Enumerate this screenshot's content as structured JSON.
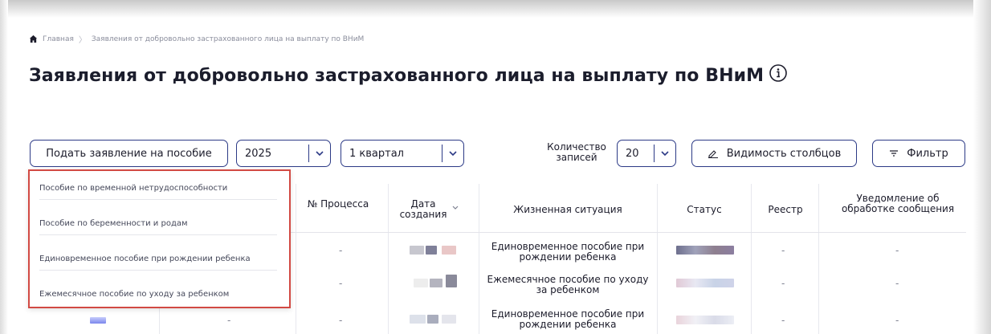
{
  "breadcrumb": {
    "home": "Главная",
    "current": "Заявления от добровольно застрахованного лица на выплату по ВНиМ"
  },
  "page": {
    "title": "Заявления от добровольно застрахованного лица на выплату по ВНиМ"
  },
  "toolbar": {
    "submit_label": "Подать заявление на пособие",
    "year_value": "2025",
    "quarter_value": "1 квартал",
    "count_label": "Количество записей",
    "count_value": "20",
    "columns_label": "Видимость столбцов",
    "filter_label": "Фильтр"
  },
  "dropdown": {
    "items": [
      "Пособие по временной нетрудоспособности",
      "Пособие по беременности и родам",
      "Единовременное пособие при рождении ребенка",
      "Ежемесячное пособие по уходу за ребенком"
    ]
  },
  "table": {
    "headers": {
      "process": "№ Процесса",
      "created": "Дата создания",
      "situation": "Жизненная ситуация",
      "status": "Статус",
      "registry": "Реестр",
      "notice": "Уведомление об обработке сообщения"
    },
    "rows": [
      {
        "process": "-",
        "situation": "Единовременное пособие при рождении ребенка",
        "registry": "-",
        "notice": "-"
      },
      {
        "process": "-",
        "situation": "Ежемесячное пособие по уходу за ребенком",
        "registry": "-",
        "notice": "-"
      },
      {
        "process": "-",
        "situation": "Единовременное пособие при рождении ребенка",
        "registry": "-",
        "notice": "-"
      }
    ]
  },
  "colors": {
    "accent": "#2c3a86",
    "highlight": "#d24a43"
  }
}
